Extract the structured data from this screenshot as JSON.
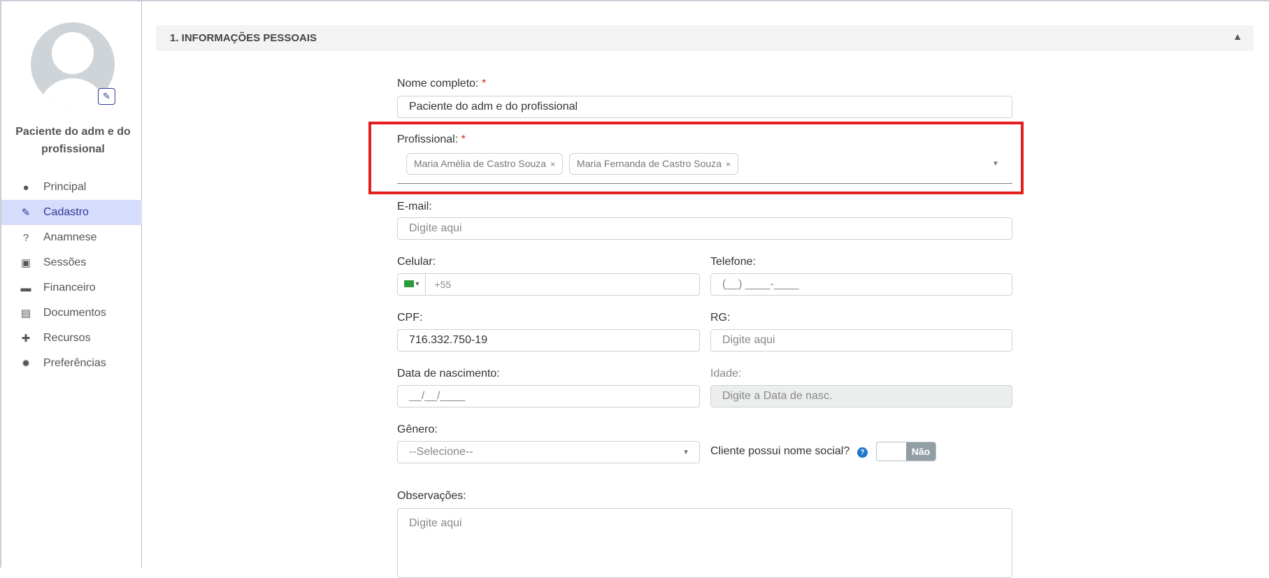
{
  "patient": {
    "name": "Paciente do adm e do profissional"
  },
  "menu": [
    {
      "label": "Principal",
      "icon": "user-icon"
    },
    {
      "label": "Cadastro",
      "icon": "edit-icon",
      "active": true
    },
    {
      "label": "Anamnese",
      "icon": "question-circle-icon"
    },
    {
      "label": "Sessões",
      "icon": "medkit-icon"
    },
    {
      "label": "Financeiro",
      "icon": "money-icon"
    },
    {
      "label": "Documentos",
      "icon": "file-icon"
    },
    {
      "label": "Recursos",
      "icon": "puzzle-icon"
    },
    {
      "label": "Preferências",
      "icon": "gear-icon"
    }
  ],
  "section": {
    "title": "1. INFORMAÇÕES PESSOAIS"
  },
  "form": {
    "required_mark": "*",
    "nome": {
      "label": "Nome completo:",
      "value": "Paciente do adm e do profissional"
    },
    "profissional": {
      "label": "Profissional:",
      "chips": [
        "Maria Amélia de Castro Souza",
        "Maria Fernanda de Castro Souza"
      ],
      "remove": "×"
    },
    "email": {
      "label": "E-mail:",
      "placeholder": "Digite aqui"
    },
    "celular": {
      "label": "Celular:",
      "prefix": "+55"
    },
    "telefone": {
      "label": "Telefone:",
      "placeholder": "(__) ____-____"
    },
    "cpf": {
      "label": "CPF:",
      "value": "716.332.750-19"
    },
    "rg": {
      "label": "RG:",
      "placeholder": "Digite aqui"
    },
    "nascimento": {
      "label": "Data de nascimento:",
      "placeholder": "__/__/____"
    },
    "idade": {
      "label": "Idade:",
      "placeholder": "Digite a Data de nasc."
    },
    "genero": {
      "label": "Gênero:",
      "value": "--Selecione--"
    },
    "nome_social": {
      "label": "Cliente possui nome social?",
      "toggle": "Não",
      "help": "?"
    },
    "observacoes": {
      "label": "Observações:",
      "placeholder": "Digite aqui"
    }
  }
}
